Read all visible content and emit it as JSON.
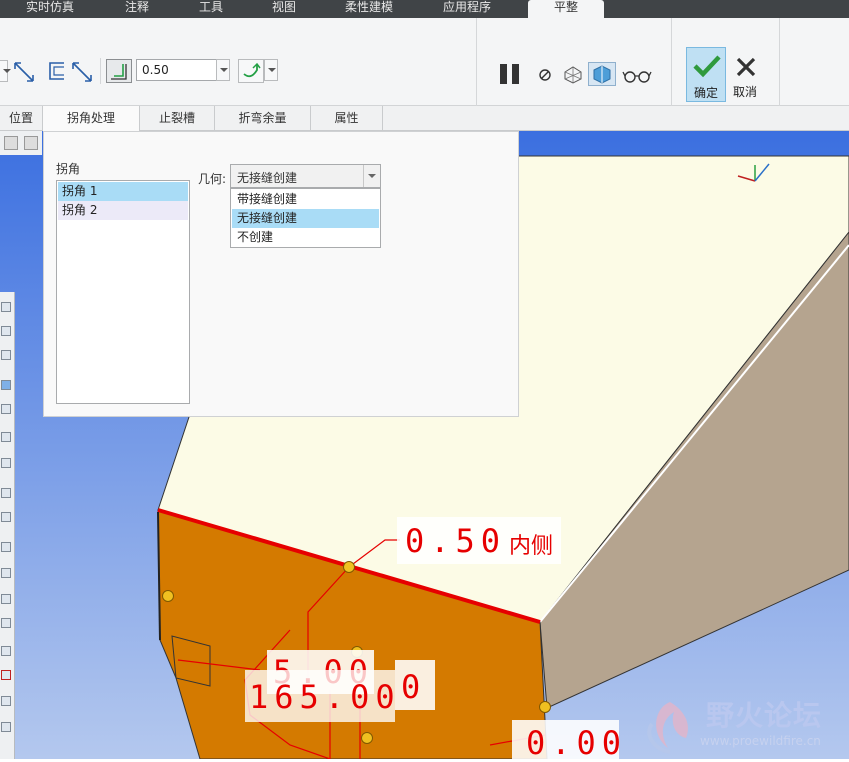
{
  "top_tabs": [
    "实时仿真",
    "注释",
    "工具",
    "视图",
    "柔性建模",
    "应用程序",
    "平整"
  ],
  "active_top_tab": "平整",
  "ribbon": {
    "thickness_value": "0.50",
    "ok_label": "确定",
    "cancel_label": "取消"
  },
  "sub_tabs": [
    "位置",
    "拐角处理",
    "止裂槽",
    "折弯余量",
    "属性"
  ],
  "active_sub_tab": "拐角处理",
  "corner_panel": {
    "list_title": "拐角",
    "corners": [
      "拐角 1",
      "拐角 2"
    ],
    "geometry_label": "几何:",
    "geometry_value": "无接缝创建",
    "geometry_options": [
      "带接缝创建",
      "无接缝创建",
      "不创建"
    ],
    "selected_option": "无接缝创建"
  },
  "model_annotations": {
    "thickness_dim": "0.50",
    "thickness_side": "内侧",
    "dim_a": "5.00",
    "dim_b": "165.00",
    "dim_c": "0",
    "dim_d": "0.00"
  },
  "watermark": {
    "text": "野火论坛",
    "url": "www.proewildfire.cn"
  },
  "colors": {
    "topbar": "#404447",
    "ribbon_bg": "#f4f5f6",
    "ok_highlight": "#bfe0f3",
    "selection_blue": "#a9dcf6",
    "viewport_blue": "#6f95e8",
    "viewport_cream": "#fcfbe6",
    "face_orange": "#d47a00",
    "dimension_red": "#e60000"
  }
}
